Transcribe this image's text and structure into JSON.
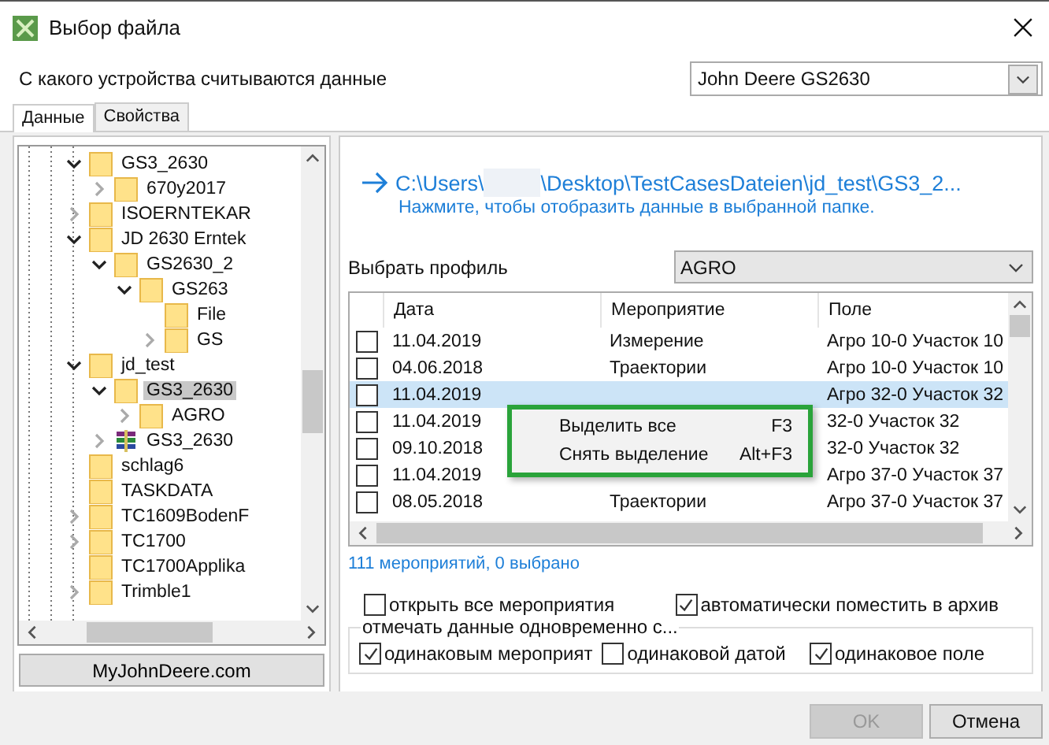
{
  "window": {
    "title": "Выбор файла"
  },
  "device": {
    "label": "С какого устройства считываются данные",
    "value": "John Deere GS2630"
  },
  "tabs": [
    {
      "label": "Данные",
      "selected": true
    },
    {
      "label": "Свойства",
      "selected": false
    }
  ],
  "tree": [
    {
      "label": "GS3_2630",
      "kind": "folder",
      "expanded": true,
      "selected": false,
      "children": [
        {
          "label": "670y2017",
          "kind": "folder",
          "expanded": false,
          "selected": false
        }
      ]
    },
    {
      "label": "ISOERNTEKAR",
      "kind": "folder",
      "expanded": false,
      "selected": false
    },
    {
      "label": "JD 2630 Erntek",
      "kind": "folder",
      "expanded": true,
      "selected": false,
      "children": [
        {
          "label": "GS2630_2",
          "kind": "folder",
          "expanded": true,
          "selected": false,
          "children": [
            {
              "label": "GS263",
              "kind": "folder",
              "expanded": true,
              "selected": false,
              "children": [
                {
                  "label": "File",
                  "kind": "folder",
                  "selected": false
                },
                {
                  "label": "GS",
                  "kind": "folder",
                  "expanded": false,
                  "selected": false
                }
              ]
            }
          ]
        }
      ]
    },
    {
      "label": "jd_test",
      "kind": "folder",
      "expanded": true,
      "selected": false,
      "children": [
        {
          "label": "GS3_2630",
          "kind": "folder",
          "expanded": true,
          "selected": true,
          "children": [
            {
              "label": "AGRO",
              "kind": "folder",
              "expanded": false,
              "selected": false
            }
          ]
        },
        {
          "label": "GS3_2630",
          "kind": "archive",
          "expanded": false,
          "selected": false
        }
      ]
    },
    {
      "label": "schlag6",
      "kind": "folder",
      "selected": false
    },
    {
      "label": "TASKDATA",
      "kind": "folder",
      "selected": false
    },
    {
      "label": "TC1609BodenF",
      "kind": "folder",
      "expanded": false,
      "selected": false
    },
    {
      "label": "TC1700",
      "kind": "folder",
      "expanded": false,
      "selected": false
    },
    {
      "label": "TC1700Applika",
      "kind": "folder",
      "selected": false
    },
    {
      "label": "Trimble1",
      "kind": "folder",
      "expanded": false,
      "selected": false
    }
  ],
  "web_button": "MyJohnDeere.com",
  "path": {
    "before": "C:\\Users\\",
    "after": "\\Desktop\\TestCasesDateien\\jd_test\\GS3_2...",
    "hint": "Нажмите, чтобы отобразить данные в выбранной папке."
  },
  "profile": {
    "label": "Выбрать профиль",
    "value": "AGRO"
  },
  "table": {
    "columns": [
      "Дата",
      "Мероприятие",
      "Поле"
    ],
    "rows": [
      {
        "checked": false,
        "selected": false,
        "date": "11.04.2019",
        "event": "Измерение",
        "field": "Агро 10-0 Участок 10"
      },
      {
        "checked": false,
        "selected": false,
        "date": "04.06.2018",
        "event": "Траектории",
        "field": "Агро 10-0 Участок 10"
      },
      {
        "checked": false,
        "selected": true,
        "date": "11.04.2019",
        "field": "Агро 32-0 Участок 32"
      },
      {
        "checked": false,
        "selected": false,
        "date": "11.04.2019",
        "field": "32-0 Участок 32"
      },
      {
        "checked": false,
        "selected": false,
        "date": "09.10.2018",
        "field": "32-0 Участок 32"
      },
      {
        "checked": false,
        "selected": false,
        "date": "11.04.2019",
        "field": "Агро 37-0 Участок 37"
      },
      {
        "checked": false,
        "selected": false,
        "date": "08.05.2018",
        "event": "Траектории",
        "field": "Агро 37-0 Участок 37"
      }
    ]
  },
  "context_menu": [
    {
      "label": "Выделить все",
      "shortcut": "F3"
    },
    {
      "label": "Снять выделение",
      "shortcut": "Alt+F3"
    }
  ],
  "summary": "111 мероприятий, 0 выбрано",
  "options": [
    {
      "label": "открыть все мероприятия",
      "checked": false
    },
    {
      "label": "автоматически поместить в архив",
      "checked": true
    }
  ],
  "group": {
    "title": "отмечать данные одновременно с...",
    "options": [
      {
        "label": "одинаковым мероприят",
        "checked": true
      },
      {
        "label": "одинаковой датой",
        "checked": false
      },
      {
        "label": "одинаковое поле",
        "checked": true
      }
    ]
  },
  "buttons": [
    {
      "label": "OK",
      "disabled": true
    },
    {
      "label": "Отмена",
      "disabled": false
    }
  ]
}
